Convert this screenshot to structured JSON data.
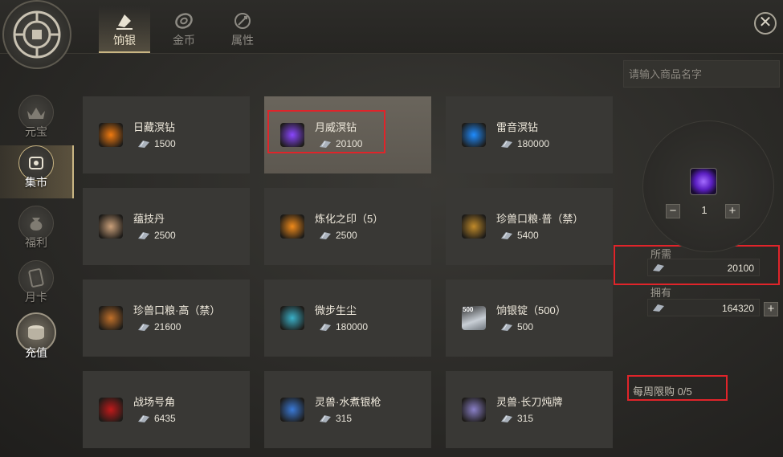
{
  "tabs": [
    {
      "label": "饷银",
      "icon": "silver-ingot-icon",
      "active": true
    },
    {
      "label": "金币",
      "icon": "gold-coin-icon",
      "active": false
    },
    {
      "label": "属性",
      "icon": "attribute-icon",
      "active": false
    }
  ],
  "sidebar": {
    "items": [
      {
        "label": "元宝",
        "icon": "ingot-icon"
      },
      {
        "label": "集市",
        "icon": "market-icon",
        "active": true
      },
      {
        "label": "福利",
        "icon": "money-bag-icon"
      },
      {
        "label": "月卡",
        "icon": "card-icon"
      },
      {
        "label": "充值",
        "icon": "coins-stack-icon"
      }
    ]
  },
  "items": [
    {
      "name": "日藏溟钻",
      "price": "1500",
      "icon": "orange-orb-icon",
      "color": "#f07a10"
    },
    {
      "name": "月威溟钻",
      "price": "20100",
      "icon": "purple-gem-icon",
      "color": "#8a46ff",
      "selected": true
    },
    {
      "name": "雷音溟钻",
      "price": "180000",
      "icon": "blue-gem-icon",
      "color": "#1e8cff"
    },
    {
      "name": "蕴技丹",
      "price": "2500",
      "icon": "pill-icon",
      "color": "#caa07a"
    },
    {
      "name": "炼化之印（5）",
      "price": "2500",
      "icon": "fire-seal-icon",
      "color": "#f08a1a"
    },
    {
      "name": "珍兽口粮·普（禁）",
      "price": "5400",
      "icon": "food-bag-icon",
      "color": "#c08a2a"
    },
    {
      "name": "珍兽口粮·高（禁）",
      "price": "21600",
      "icon": "food-bag-purple-icon",
      "color": "#c0702a"
    },
    {
      "name": "微步生尘",
      "price": "180000",
      "icon": "boot-icon",
      "color": "#3ab0c8"
    },
    {
      "name": "饷银锭（500）",
      "price": "500",
      "icon": "silver-bar-icon",
      "color": "#9aa3ad",
      "badge": "500"
    },
    {
      "name": "战场号角",
      "price": "6435",
      "icon": "horn-icon",
      "color": "#c01a1a"
    },
    {
      "name": "灵兽·水煮银枪",
      "price": "315",
      "icon": "spear-icon",
      "color": "#3a7ad8"
    },
    {
      "name": "灵兽·长刀炖牌",
      "price": "315",
      "icon": "blade-icon",
      "color": "#8a80c8"
    }
  ],
  "search": {
    "placeholder": "请输入商品名字"
  },
  "purchase": {
    "quantity": "1",
    "required_label": "所需",
    "required_value": "20100",
    "owned_label": "拥有",
    "owned_value": "164320",
    "weekly_limit": "每周限购  0/5"
  },
  "colors": {
    "accent": "#c9b583",
    "highlight": "#e0242a"
  }
}
